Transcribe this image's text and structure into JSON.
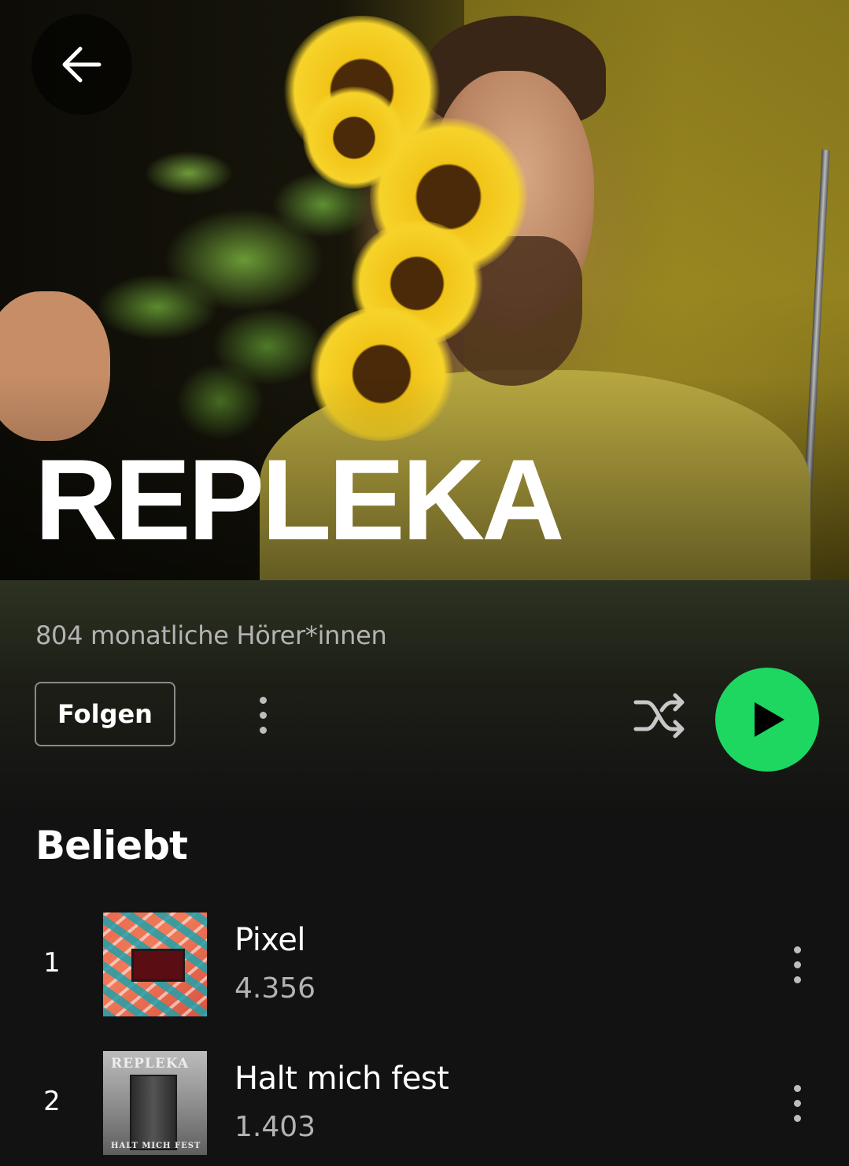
{
  "artist": {
    "name": "REPLEKA",
    "monthly_listeners": "804 monatliche Hörer*innen"
  },
  "actions": {
    "follow_label": "Folgen",
    "accent_color": "#1ed760"
  },
  "icons": {
    "back": "arrow-left-icon",
    "more": "more-vertical-icon",
    "shuffle": "shuffle-icon",
    "play": "play-icon"
  },
  "popular": {
    "title": "Beliebt",
    "tracks": [
      {
        "rank": "1",
        "title": "Pixel",
        "plays": "4.356"
      },
      {
        "rank": "2",
        "title": "Halt mich fest",
        "plays": "1.403",
        "cover_text_top": "REPLEKA",
        "cover_text_bottom": "HALT MICH FEST"
      }
    ]
  }
}
